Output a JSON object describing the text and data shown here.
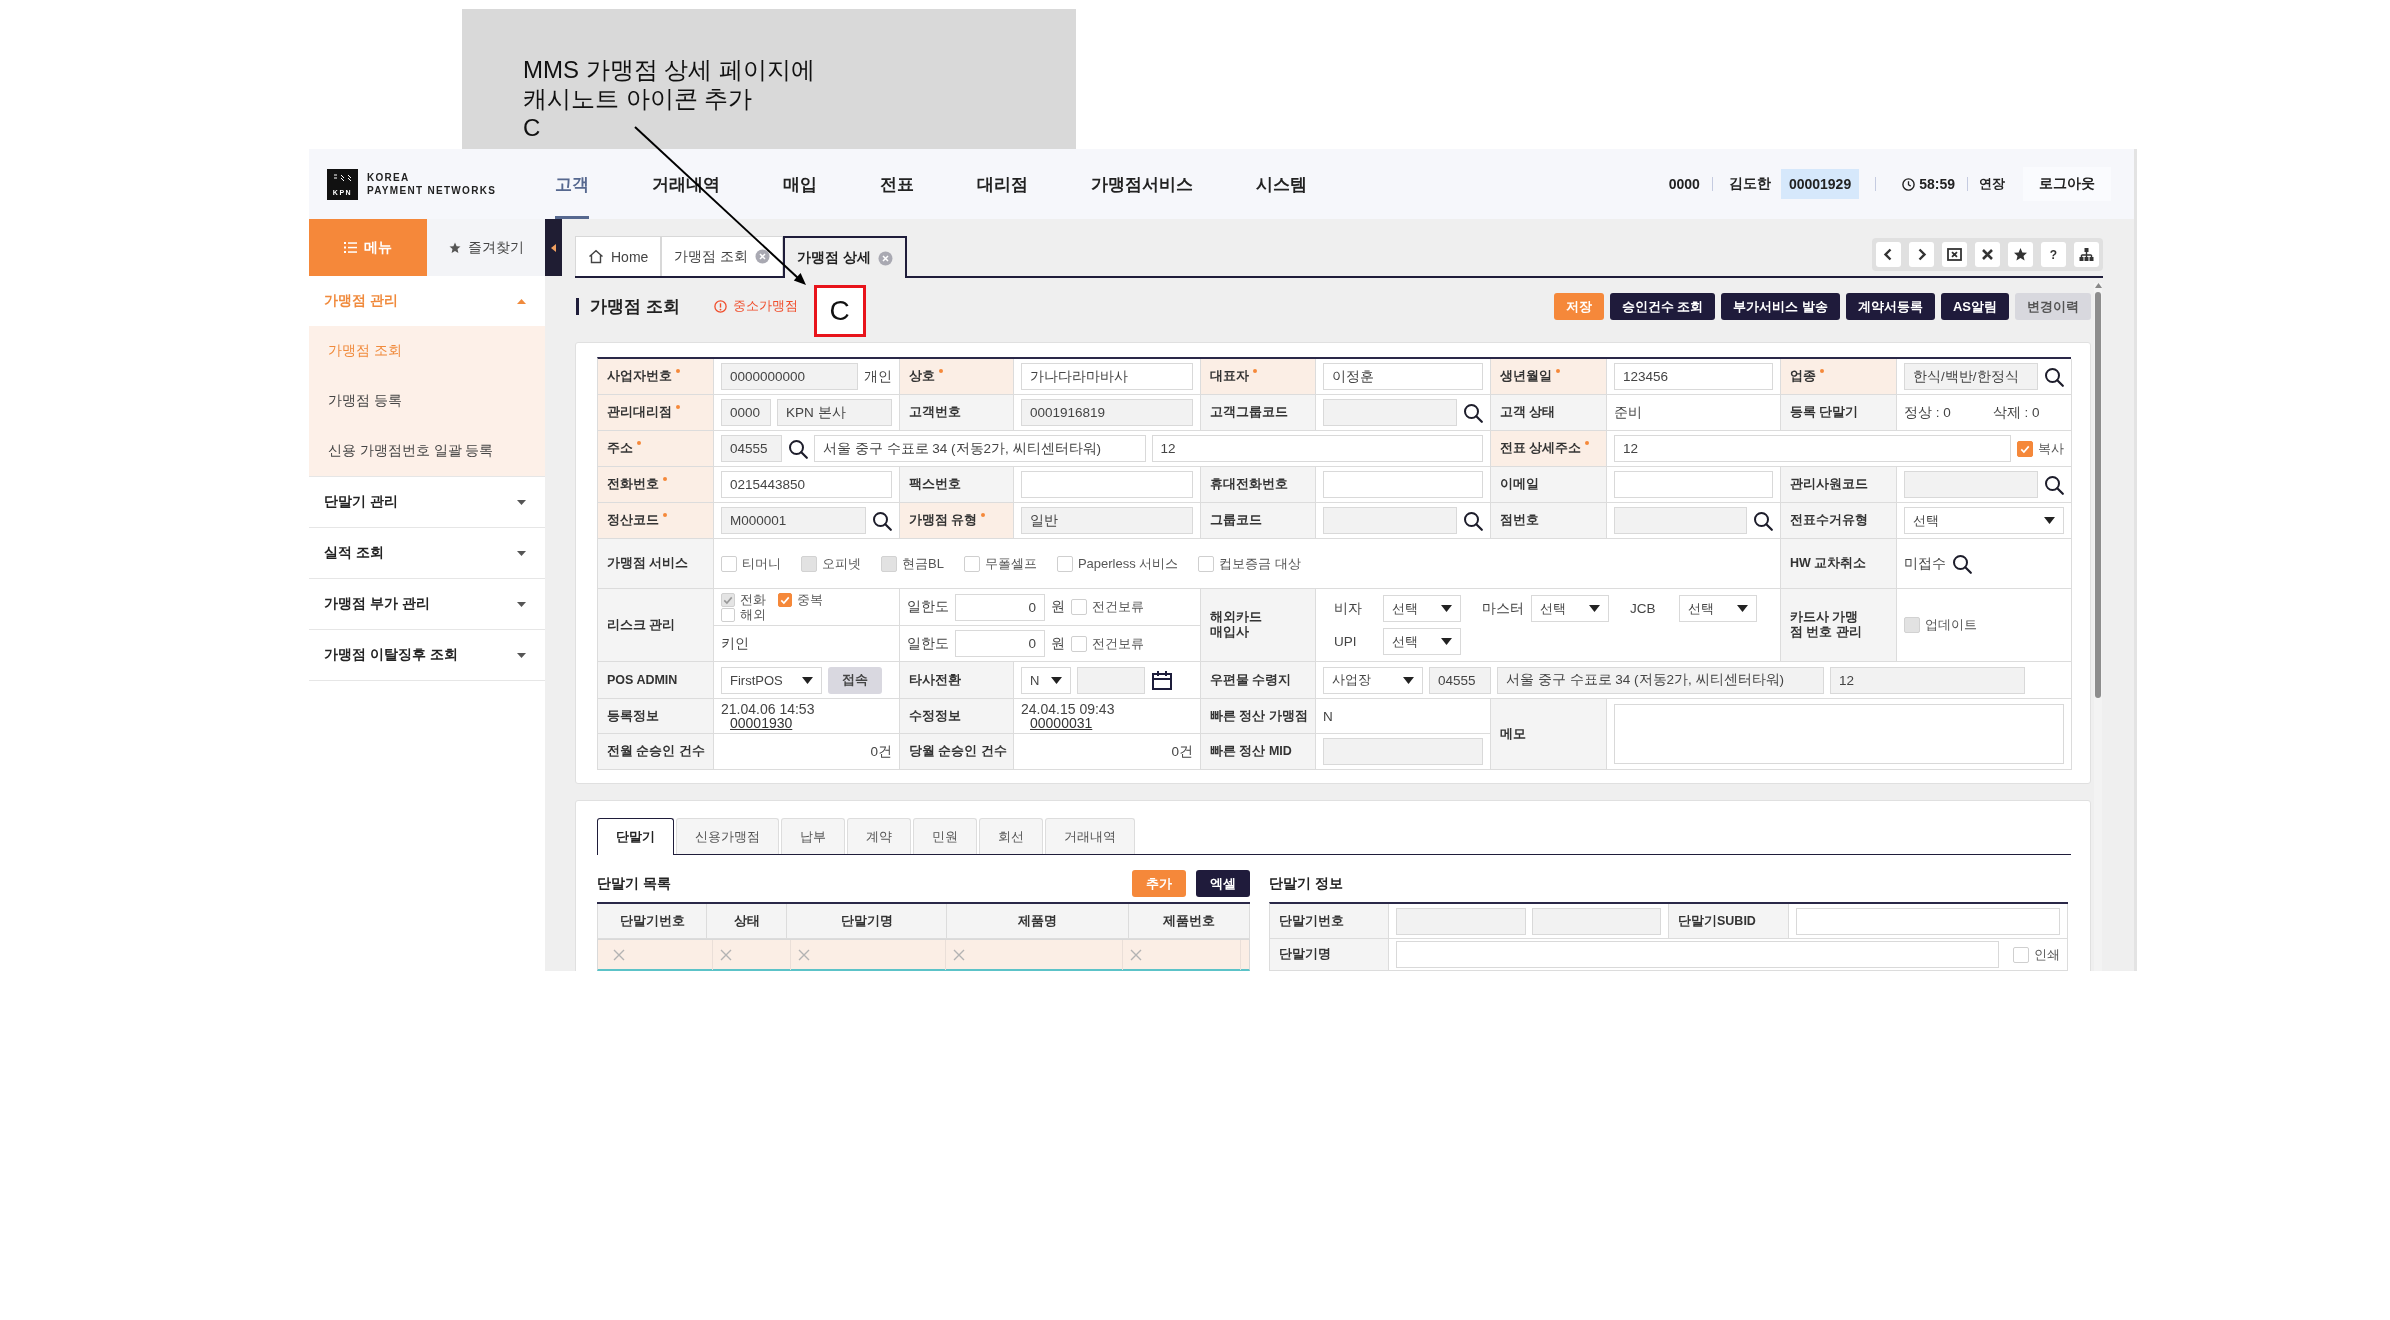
{
  "annotation": {
    "lines": [
      "MMS 가맹점 상세 페이지에",
      "캐시노트 아이콘 추가",
      "C"
    ]
  },
  "header": {
    "logo": {
      "mark": "KPN",
      "line1": "KOREA",
      "line2": "PAYMENT NETWORKS"
    },
    "nav": [
      {
        "label": "고객",
        "selected": true
      },
      {
        "label": "거래내역",
        "selected": false
      },
      {
        "label": "매입",
        "selected": false
      },
      {
        "label": "전표",
        "selected": false
      },
      {
        "label": "대리점",
        "selected": false
      },
      {
        "label": "가맹점서비스",
        "selected": false
      },
      {
        "label": "시스템",
        "selected": false
      }
    ],
    "user": {
      "branch": "0000",
      "name": "김도한",
      "employee_id": "00001929",
      "timer": "58:59",
      "extend": "연장",
      "logout": "로그아웃"
    }
  },
  "sidebar": {
    "tabs": [
      {
        "label": "메뉴",
        "selected": true
      },
      {
        "label": "즐겨찾기",
        "selected": false
      }
    ],
    "items": [
      {
        "label": "가맹점 관리",
        "expanded": true,
        "children": [
          {
            "label": "가맹점 조회",
            "selected": true
          },
          {
            "label": "가맹점 등록",
            "selected": false
          },
          {
            "label": "신용 가맹점번호 일괄 등록",
            "selected": false
          }
        ]
      },
      {
        "label": "단말기 관리",
        "expanded": false
      },
      {
        "label": "실적 조회",
        "expanded": false
      },
      {
        "label": "가맹점 부가 관리",
        "expanded": false
      },
      {
        "label": "가맹점 이탈징후 조회",
        "expanded": false
      }
    ]
  },
  "page_tabs": [
    {
      "label": "Home",
      "kind": "home",
      "selected": false
    },
    {
      "label": "가맹점 조회",
      "kind": "closable",
      "selected": false
    },
    {
      "label": "가맹점 상세",
      "kind": "closable",
      "selected": true
    }
  ],
  "toolbar": {
    "help": "?"
  },
  "page": {
    "title": "가맹점 조회",
    "badge": "중소가맹점",
    "marker": "C"
  },
  "actions": [
    {
      "label": "저장",
      "kind": "primary"
    },
    {
      "label": "승인건수 조회",
      "kind": "dark"
    },
    {
      "label": "부가서비스 발송",
      "kind": "dark"
    },
    {
      "label": "계약서등록",
      "kind": "dark"
    },
    {
      "label": "AS알림",
      "kind": "dark"
    },
    {
      "label": "변경이력",
      "kind": "muted"
    }
  ],
  "form": {
    "rows": [
      {
        "fields": [
          {
            "label": "사업자번호",
            "required": true,
            "parts": [
              {
                "kind": "input",
                "value": "0000000000",
                "disabled": true
              },
              {
                "kind": "text",
                "value": "개인"
              }
            ]
          },
          {
            "label": "상호",
            "required": true,
            "parts": [
              {
                "kind": "input",
                "value": "가나다라마바사",
                "disabled": false
              }
            ]
          },
          {
            "label": "대표자",
            "required": true,
            "parts": [
              {
                "kind": "input",
                "value": "이정훈",
                "disabled": false
              }
            ]
          },
          {
            "label": "생년월일",
            "required": true,
            "parts": [
              {
                "kind": "input",
                "value": "123456",
                "disabled": false
              }
            ]
          },
          {
            "label": "업종",
            "required": true,
            "parts": [
              {
                "kind": "input",
                "value": "한식/백반/한정식",
                "disabled": true
              },
              {
                "kind": "search"
              }
            ]
          }
        ]
      },
      {
        "fields": [
          {
            "label": "관리대리점",
            "required": true,
            "parts": [
              {
                "kind": "input",
                "value": "0000",
                "disabled": true
              },
              {
                "kind": "input",
                "value": "KPN 본사",
                "disabled": true
              }
            ]
          },
          {
            "label": "고객번호",
            "required": false,
            "parts": [
              {
                "kind": "input",
                "value": "0001916819",
                "disabled": true
              }
            ]
          },
          {
            "label": "고객그룹코드",
            "required": false,
            "parts": [
              {
                "kind": "input",
                "disabled": true
              },
              {
                "kind": "search"
              }
            ]
          },
          {
            "label": "고객 상태",
            "required": false,
            "parts": [
              {
                "kind": "text",
                "value": "준비"
              }
            ]
          },
          {
            "label": "등록 단말기",
            "required": false,
            "parts": [
              {
                "kind": "text",
                "value": "정상 : 0"
              },
              {
                "kind": "text",
                "value": "삭제 : 0"
              }
            ]
          }
        ]
      },
      {
        "fields": [
          {
            "label": "주소",
            "required": true,
            "parts": [
              {
                "kind": "input",
                "value": "04555",
                "disabled": true
              },
              {
                "kind": "search"
              },
              {
                "kind": "input",
                "value": "서울 중구 수표로 34 (저동2가, 씨티센터타워)",
                "disabled": false
              },
              {
                "kind": "input",
                "value": "12",
                "disabled": false
              }
            ]
          },
          {
            "label": "전표 상세주소",
            "required": true,
            "parts": [
              {
                "kind": "input",
                "value": "12",
                "disabled": false
              },
              {
                "kind": "checkbox",
                "label": "복사",
                "checked": true,
                "disabled": false
              }
            ]
          }
        ]
      },
      {
        "fields": [
          {
            "label": "전화번호",
            "required": true,
            "parts": [
              {
                "kind": "input",
                "value": "0215443850",
                "disabled": false
              }
            ]
          },
          {
            "label": "팩스번호",
            "required": false,
            "parts": [
              {
                "kind": "input",
                "disabled": false
              }
            ]
          },
          {
            "label": "휴대전화번호",
            "required": false,
            "parts": [
              {
                "kind": "input",
                "disabled": false
              }
            ]
          },
          {
            "label": "이메일",
            "required": false,
            "parts": [
              {
                "kind": "input",
                "disabled": false
              }
            ]
          },
          {
            "label": "관리사원코드",
            "required": false,
            "parts": [
              {
                "kind": "input",
                "disabled": true
              },
              {
                "kind": "search"
              }
            ]
          }
        ]
      },
      {
        "fields": [
          {
            "label": "정산코드",
            "required": true,
            "parts": [
              {
                "kind": "input",
                "value": "M000001",
                "disabled": true
              },
              {
                "kind": "search"
              }
            ]
          },
          {
            "label": "가맹점 유형",
            "required": true,
            "parts": [
              {
                "kind": "input",
                "value": "일반",
                "disabled": true
              }
            ]
          },
          {
            "label": "그룹코드",
            "required": false,
            "parts": [
              {
                "kind": "input",
                "disabled": true
              },
              {
                "kind": "search"
              }
            ]
          },
          {
            "label": "점번호",
            "required": false,
            "parts": [
              {
                "kind": "input",
                "disabled": true
              },
              {
                "kind": "search"
              }
            ]
          },
          {
            "label": "전표수거유형",
            "required": false,
            "parts": [
              {
                "kind": "select",
                "value": "선택"
              }
            ]
          }
        ]
      },
      {
        "fields": [
          {
            "label": "가맹점 서비스",
            "required": false,
            "parts": [
              {
                "kind": "checkbox",
                "label": "티머니",
                "checked": false,
                "disabled": false
              },
              {
                "kind": "checkbox",
                "label": "오피넷",
                "checked": false,
                "disabled": true
              },
              {
                "kind": "checkbox",
                "label": "현금BL",
                "checked": false,
                "disabled": true
              },
              {
                "kind": "checkbox",
                "label": "무폴셀프",
                "checked": false,
                "disabled": false
              },
              {
                "kind": "checkbox",
                "label": "Paperless 서비스",
                "checked": false,
                "disabled": false
              },
              {
                "kind": "checkbox",
                "label": "컵보증금 대상",
                "checked": false,
                "disabled": false
              }
            ]
          },
          {
            "label": "HW 교차취소",
            "required": false,
            "parts": [
              {
                "kind": "text",
                "value": "미접수"
              },
              {
                "kind": "search"
              }
            ]
          }
        ]
      },
      {
        "fields": [
          {
            "label": "리스크 관리",
            "required": false,
            "lines": [
              {
                "left": [
                  {
                    "kind": "checkbox",
                    "label": "전화",
                    "checked": true,
                    "disabled": true
                  },
                  {
                    "kind": "checkbox",
                    "label": "중복",
                    "checked": true,
                    "disabled": false
                  },
                  {
                    "kind": "checkbox",
                    "label": "해외",
                    "checked": false,
                    "disabled": false
                  }
                ],
                "right": [
                  {
                    "kind": "text",
                    "value": "일한도"
                  },
                  {
                    "kind": "number",
                    "value": "0",
                    "disabled": false
                  },
                  {
                    "kind": "text",
                    "value": "원"
                  },
                  {
                    "kind": "checkbox",
                    "label": "전건보류",
                    "checked": false,
                    "disabled": false
                  }
                ]
              },
              {
                "left": [
                  {
                    "kind": "text",
                    "value": "키인"
                  }
                ],
                "right": [
                  {
                    "kind": "text",
                    "value": "일한도"
                  },
                  {
                    "kind": "number",
                    "value": "0",
                    "disabled": false
                  },
                  {
                    "kind": "text",
                    "value": "원"
                  },
                  {
                    "kind": "checkbox",
                    "label": "전건보류",
                    "checked": false,
                    "disabled": false
                  }
                ]
              }
            ]
          },
          {
            "label": "해외카드 매입사",
            "required": false,
            "parts": [
              {
                "kind": "labeled_select",
                "label": "비자",
                "value": "선택"
              },
              {
                "kind": "labeled_select",
                "label": "마스터",
                "value": "선택"
              },
              {
                "kind": "labeled_select",
                "label": "JCB",
                "value": "선택"
              },
              {
                "kind": "labeled_select",
                "label": "UPI",
                "value": "선택"
              }
            ]
          },
          {
            "label": "카드사 가맹점 번호 관리",
            "required": false,
            "parts": [
              {
                "kind": "checkbox",
                "label": "업데이트",
                "checked": false,
                "disabled": true
              }
            ]
          }
        ]
      },
      {
        "fields": [
          {
            "label": "POS ADMIN",
            "required": false,
            "parts": [
              {
                "kind": "select",
                "value": "FirstPOS"
              },
              {
                "kind": "button",
                "label": "접속"
              }
            ]
          },
          {
            "label": "타사전환",
            "required": false,
            "parts": [
              {
                "kind": "select",
                "value": "N"
              },
              {
                "kind": "input",
                "disabled": true
              },
              {
                "kind": "calendar"
              }
            ]
          },
          {
            "label": "우편물 수령지",
            "required": false,
            "parts": [
              {
                "kind": "select",
                "value": "사업장"
              },
              {
                "kind": "input",
                "value": "04555",
                "disabled": true
              },
              {
                "kind": "input",
                "value": "서울 중구 수표로 34 (저동2가, 씨티센터타워)",
                "disabled": true
              },
              {
                "kind": "input",
                "value": "12",
                "disabled": true
              }
            ]
          }
        ]
      },
      {
        "fields": [
          {
            "label": "등록정보",
            "required": false,
            "parts": [
              {
                "kind": "text",
                "value": "21.04.06 14:53"
              },
              {
                "kind": "link",
                "value": "00001930"
              }
            ]
          },
          {
            "label": "수정정보",
            "required": false,
            "parts": [
              {
                "kind": "text",
                "value": "24.04.15 09:43"
              },
              {
                "kind": "link",
                "value": "00000031"
              }
            ]
          },
          {
            "label": "빠른 정산 가맹점",
            "required": false,
            "parts": [
              {
                "kind": "text",
                "value": "N"
              }
            ]
          },
          {
            "label": "메모",
            "required": false,
            "parts": [
              {
                "kind": "textarea"
              }
            ]
          }
        ]
      },
      {
        "fields": [
          {
            "label": "전월 순승인 건수",
            "required": false,
            "parts": [
              {
                "kind": "count",
                "value": "0건"
              }
            ]
          },
          {
            "label": "당월 순승인 건수",
            "required": false,
            "parts": [
              {
                "kind": "count",
                "value": "0건"
              }
            ]
          },
          {
            "label": "빠른 정산 MID",
            "required": false,
            "parts": [
              {
                "kind": "input",
                "disabled": true
              }
            ]
          }
        ]
      }
    ]
  },
  "detail_tabs": [
    {
      "label": "단말기",
      "selected": true
    },
    {
      "label": "신용가맹점",
      "selected": false
    },
    {
      "label": "납부",
      "selected": false
    },
    {
      "label": "계약",
      "selected": false
    },
    {
      "label": "민원",
      "selected": false
    },
    {
      "label": "회선",
      "selected": false
    },
    {
      "label": "거래내역",
      "selected": false
    }
  ],
  "terminal_list": {
    "title": "단말기 목록",
    "buttons": [
      {
        "label": "추가",
        "kind": "primary"
      },
      {
        "label": "엑셀",
        "kind": "dark"
      }
    ],
    "columns": [
      "단말기번호",
      "상태",
      "단말기명",
      "제품명",
      "제품번호"
    ],
    "rows": [
      {
        "selected": true
      }
    ]
  },
  "terminal_info": {
    "title": "단말기 정보",
    "fields": [
      {
        "label": "단말기번호",
        "parts": [
          {
            "kind": "input",
            "disabled": true
          },
          {
            "kind": "input",
            "disabled": true
          }
        ]
      },
      {
        "label": "단말기SUBID",
        "parts": [
          {
            "kind": "input",
            "disabled": false
          }
        ]
      },
      {
        "label": "단말기명",
        "parts": [
          {
            "kind": "input",
            "disabled": false
          },
          {
            "kind": "checkbox",
            "label": "인쇄",
            "checked": false,
            "disabled": false
          }
        ]
      }
    ]
  }
}
